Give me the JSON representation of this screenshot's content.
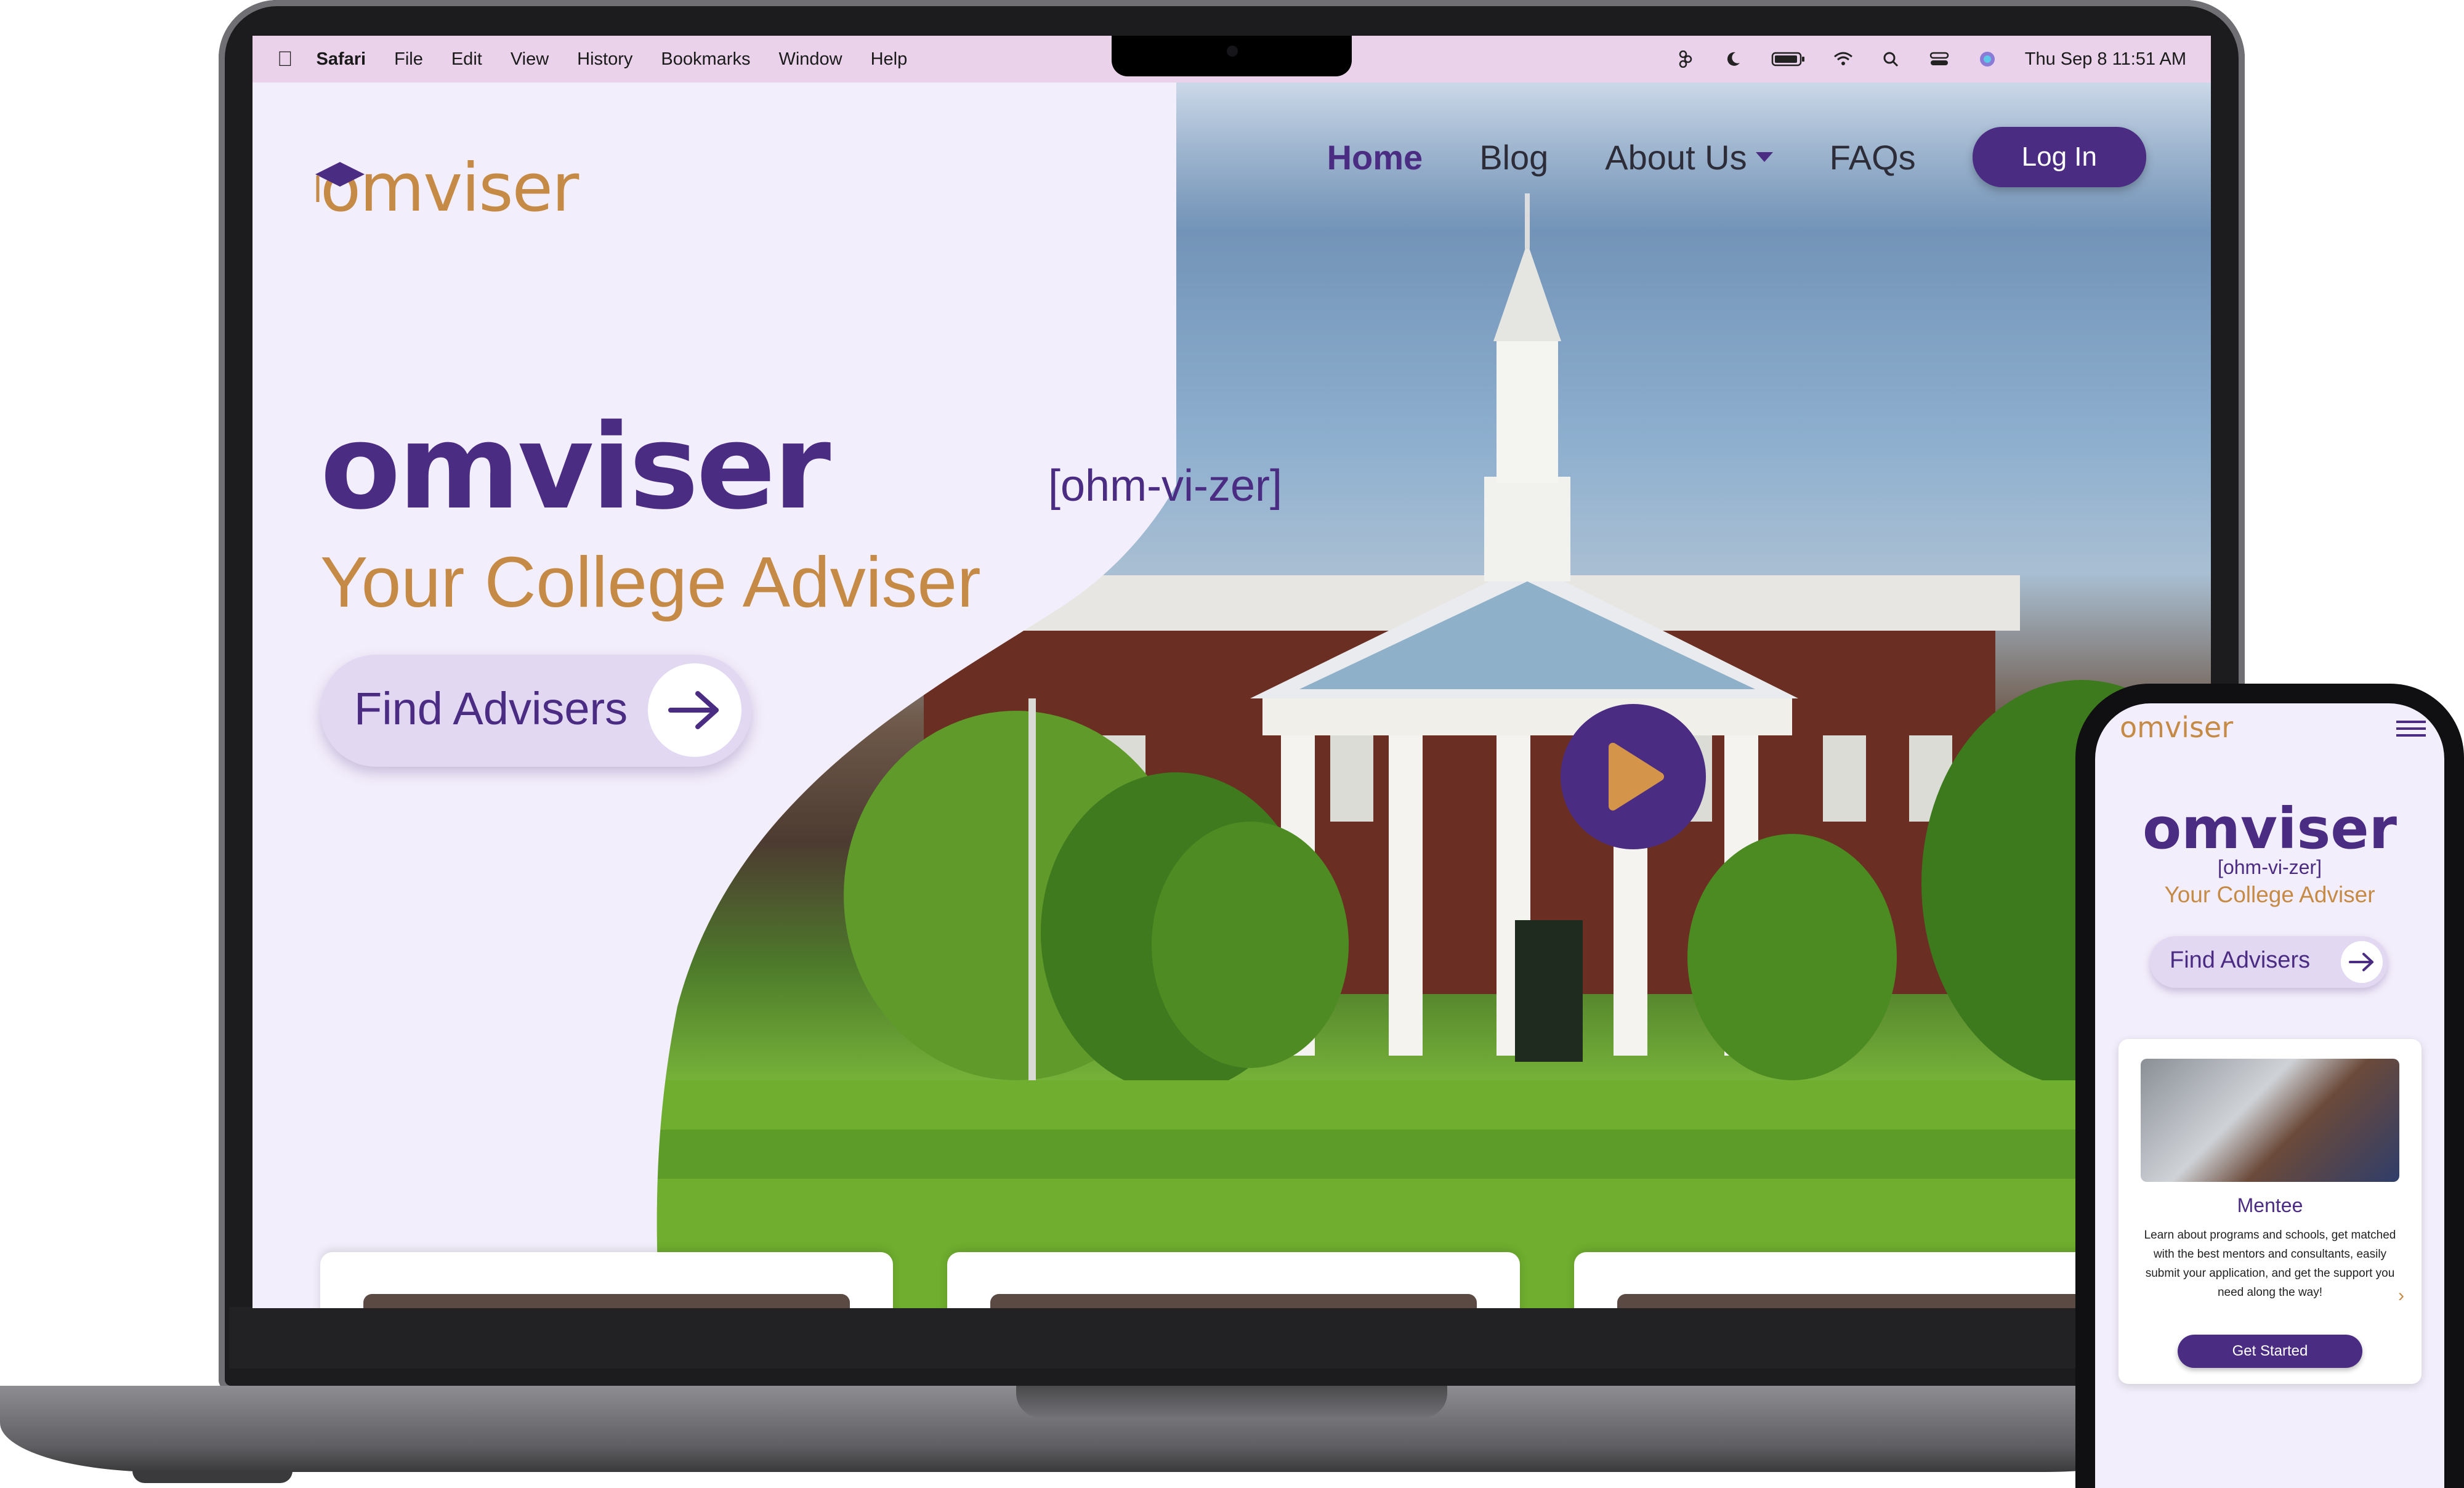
{
  "menubar": {
    "app_name": "Safari",
    "items": [
      "File",
      "Edit",
      "View",
      "History",
      "Bookmarks",
      "Window",
      "Help"
    ],
    "datetime": "Thu Sep 8  11:51 AM"
  },
  "site": {
    "logo_text": "omviser",
    "nav": {
      "home": "Home",
      "blog": "Blog",
      "about": "About Us",
      "faqs": "FAQs",
      "login": "Log In"
    },
    "hero": {
      "title": "omviser",
      "pronunciation": "[ohm-vi-zer]",
      "tagline": "Your College Adviser",
      "find_button": "Find Advisers"
    }
  },
  "mobile": {
    "logo_text": "omviser",
    "title": "omviser",
    "pronunciation": "[ohm-vi-zer]",
    "tagline": "Your College Adviser",
    "find_button": "Find Advisers",
    "card": {
      "title": "Mentee",
      "description": "Learn about programs and schools, get matched with the best mentors and consultants, easily submit your application, and get the support you need along the way!",
      "cta": "Get Started"
    }
  },
  "colors": {
    "brand_purple": "#4b2c83",
    "accent_gold": "#c58b46",
    "page_bg": "#f3eefb"
  },
  "icons": [
    "apple-icon",
    "figma-icon",
    "moon-icon",
    "battery-icon",
    "wifi-icon",
    "search-icon",
    "control-center-icon",
    "siri-icon",
    "graduation-cap-icon",
    "arrow-right-icon",
    "play-icon",
    "hamburger-menu-icon",
    "chevron-right-icon"
  ]
}
